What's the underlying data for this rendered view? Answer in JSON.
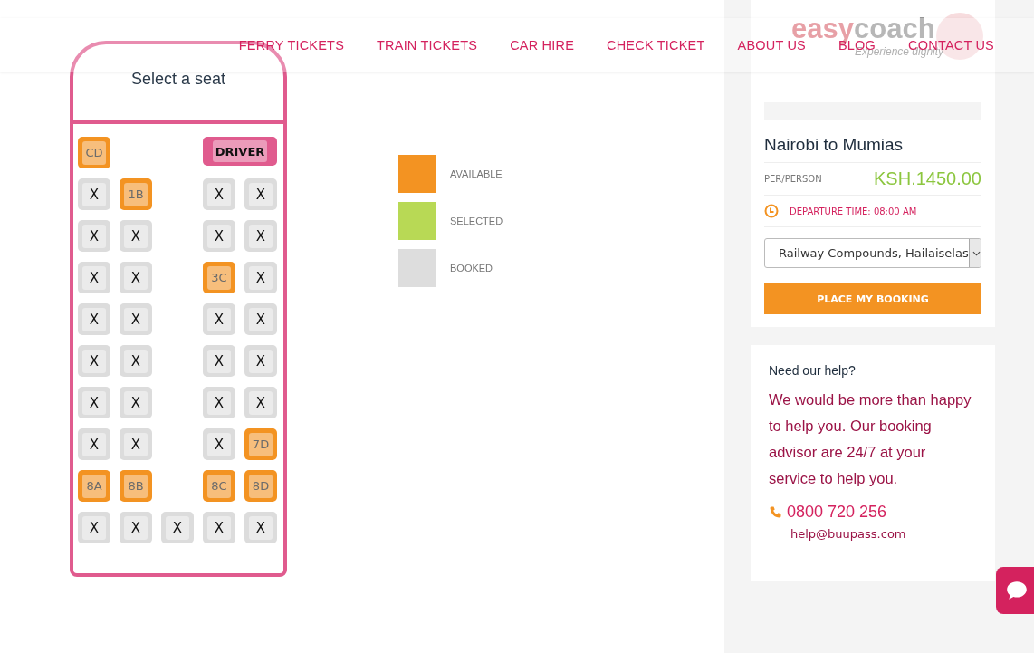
{
  "nav": [
    {
      "label": "FERRY TICKETS"
    },
    {
      "label": "TRAIN TICKETS"
    },
    {
      "label": "CAR HIRE"
    },
    {
      "label": "CHECK TICKET"
    },
    {
      "label": "ABOUT US"
    },
    {
      "label": "BLOG"
    },
    {
      "label": "CONTACT US"
    }
  ],
  "logo": {
    "name_a": "easy",
    "name_b": "coach",
    "tagline": "Experience dignity"
  },
  "seat_map": {
    "title": "Select a seat",
    "rows": [
      [
        {
          "kind": "seat",
          "label": "CD",
          "booked": false
        },
        {
          "kind": "gap"
        },
        {
          "kind": "gap"
        },
        {
          "kind": "driver",
          "label": "DRIVER"
        }
      ],
      [
        {
          "kind": "seat",
          "label": "X",
          "booked": true
        },
        {
          "kind": "seat",
          "label": "1B",
          "booked": false
        },
        {
          "kind": "gap"
        },
        {
          "kind": "seat",
          "label": "X",
          "booked": true
        },
        {
          "kind": "seat",
          "label": "X",
          "booked": true
        }
      ],
      [
        {
          "kind": "seat",
          "label": "X",
          "booked": true
        },
        {
          "kind": "seat",
          "label": "X",
          "booked": true
        },
        {
          "kind": "gap"
        },
        {
          "kind": "seat",
          "label": "X",
          "booked": true
        },
        {
          "kind": "seat",
          "label": "X",
          "booked": true
        }
      ],
      [
        {
          "kind": "seat",
          "label": "X",
          "booked": true
        },
        {
          "kind": "seat",
          "label": "X",
          "booked": true
        },
        {
          "kind": "gap"
        },
        {
          "kind": "seat",
          "label": "3C",
          "booked": false
        },
        {
          "kind": "seat",
          "label": "X",
          "booked": true
        }
      ],
      [
        {
          "kind": "seat",
          "label": "X",
          "booked": true
        },
        {
          "kind": "seat",
          "label": "X",
          "booked": true
        },
        {
          "kind": "gap"
        },
        {
          "kind": "seat",
          "label": "X",
          "booked": true
        },
        {
          "kind": "seat",
          "label": "X",
          "booked": true
        }
      ],
      [
        {
          "kind": "seat",
          "label": "X",
          "booked": true
        },
        {
          "kind": "seat",
          "label": "X",
          "booked": true
        },
        {
          "kind": "gap"
        },
        {
          "kind": "seat",
          "label": "X",
          "booked": true
        },
        {
          "kind": "seat",
          "label": "X",
          "booked": true
        }
      ],
      [
        {
          "kind": "seat",
          "label": "X",
          "booked": true
        },
        {
          "kind": "seat",
          "label": "X",
          "booked": true
        },
        {
          "kind": "gap"
        },
        {
          "kind": "seat",
          "label": "X",
          "booked": true
        },
        {
          "kind": "seat",
          "label": "X",
          "booked": true
        }
      ],
      [
        {
          "kind": "seat",
          "label": "X",
          "booked": true
        },
        {
          "kind": "seat",
          "label": "X",
          "booked": true
        },
        {
          "kind": "gap"
        },
        {
          "kind": "seat",
          "label": "X",
          "booked": true
        },
        {
          "kind": "seat",
          "label": "7D",
          "booked": false
        }
      ],
      [
        {
          "kind": "seat",
          "label": "8A",
          "booked": false
        },
        {
          "kind": "seat",
          "label": "8B",
          "booked": false
        },
        {
          "kind": "gap"
        },
        {
          "kind": "seat",
          "label": "8C",
          "booked": false
        },
        {
          "kind": "seat",
          "label": "8D",
          "booked": false
        }
      ],
      [
        {
          "kind": "seat",
          "label": "X",
          "booked": true
        },
        {
          "kind": "seat",
          "label": "X",
          "booked": true
        },
        {
          "kind": "seat",
          "label": "X",
          "booked": true
        },
        {
          "kind": "seat",
          "label": "X",
          "booked": true
        },
        {
          "kind": "seat",
          "label": "X",
          "booked": true
        }
      ]
    ]
  },
  "legend": [
    {
      "label": "AVAILABLE",
      "color": "#f39322"
    },
    {
      "label": "SELECTED",
      "color": "#b8d955"
    },
    {
      "label": "BOOKED",
      "color": "#dddddd"
    }
  ],
  "trip": {
    "route": "Nairobi to Mumias",
    "per_label": "PER/PERSON",
    "price": "KSH.1450.00",
    "departure": "DEPARTURE TIME: 08:00 AM",
    "pickup": "Railway Compounds, Hailaiselas",
    "book_button": "PLACE MY BOOKING"
  },
  "help": {
    "title": "Need our help?",
    "text": "We would be more than happy to help you. Our booking advisor are 24/7 at your service to help you.",
    "phone": "0800 720 256",
    "email": "help@buupass.com"
  }
}
